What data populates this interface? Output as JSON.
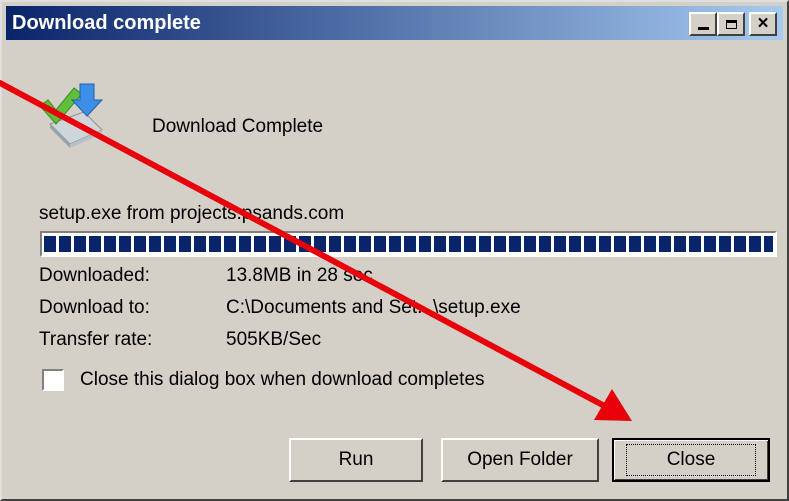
{
  "window": {
    "title": "Download complete",
    "controls": [
      "minimize-icon",
      "maximize-icon",
      "close-icon"
    ]
  },
  "content": {
    "heading": "Download Complete",
    "source": "setup.exe from projects.psands.com",
    "progress_percent": 100,
    "info": [
      {
        "label": "Downloaded:",
        "value": "13.8MB in 28 sec"
      },
      {
        "label": "Download to:",
        "value": "C:\\Documents and Set...\\setup.exe"
      },
      {
        "label": "Transfer rate:",
        "value": "505KB/Sec"
      }
    ],
    "checkbox": {
      "label": "Close this dialog box when download completes",
      "checked": false
    }
  },
  "buttons": {
    "run": "Run",
    "open_folder": "Open Folder",
    "close": "Close"
  },
  "colors": {
    "titlebar_start": "#0a246a",
    "titlebar_end": "#a6caf0",
    "dialog_bg": "#d4d0c8",
    "progress_fill": "#0a246a",
    "annotation_arrow": "#e8000b"
  },
  "icons": {
    "app": "download-complete-icon",
    "annotation": "red-arrow-annotation"
  }
}
